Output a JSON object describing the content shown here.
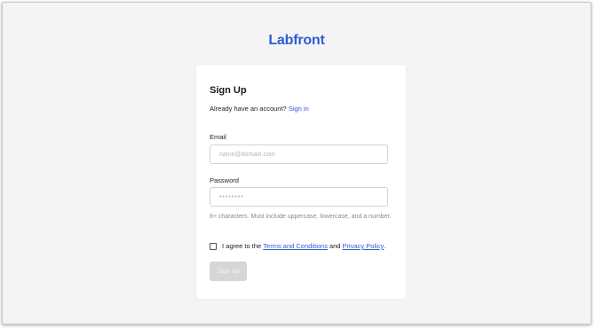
{
  "brand": {
    "logo_text": "Labfront",
    "accent_color": "#2f5bd3"
  },
  "signup": {
    "title": "Sign Up",
    "have_account_text": "Already have an account?",
    "sign_in_link": "Sign in",
    "email_label": "Email",
    "email_placeholder": "name@domain.com",
    "password_label": "Password",
    "password_placeholder": "••••••••",
    "password_hint": "8+ characters. Must include uppercase, lowercase, and a number.",
    "agree_prefix": "I agree to the",
    "terms_link": "Terms and Conditions",
    "agree_and": "and",
    "privacy_link": "Privacy Policy",
    "agree_suffix": ".",
    "terms_checked": false,
    "submit_label": "Sign Up",
    "submit_disabled": true
  }
}
